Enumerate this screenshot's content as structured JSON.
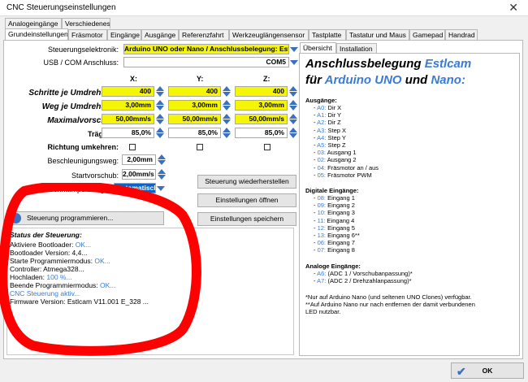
{
  "window": {
    "title": "CNC Steuerungseinstellungen",
    "close": "✕"
  },
  "tabs_row1": [
    "Analogeingänge",
    "Verschiedenes"
  ],
  "tabs_row2": [
    "Grundeinstellungen",
    "Fräsmotor",
    "Eingänge",
    "Ausgänge",
    "Referenzfahrt",
    "Werkzeuglängensensor",
    "Tastplatte",
    "Tastatur und Maus",
    "Gamepad",
    "Handrad"
  ],
  "form": {
    "steuerungselektronik_label": "Steuerungselektronik:",
    "steuerungselektronik_value": "Arduino UNO oder Nano / Anschlussbelegung: Estlcam",
    "usb_label": "USB / COM Anschluss:",
    "usb_value": "COM5",
    "axis_headers": [
      "X:",
      "Y:",
      "Z:"
    ],
    "rows": [
      {
        "label": "Schritte je Umdrehung:",
        "values": [
          "400",
          "400",
          "400"
        ]
      },
      {
        "label": "Weg je Umdrehung:",
        "values": [
          "3,00mm",
          "3,00mm",
          "3,00mm"
        ]
      },
      {
        "label": "Maximalvorschub:",
        "values": [
          "50,00mm/s",
          "50,00mm/s",
          "50,00mm/s"
        ]
      },
      {
        "label": "Trägheit:",
        "values": [
          "85,0%",
          "85,0%",
          "85,0%"
        ]
      }
    ],
    "richtung_label": "Richtung umkehren:",
    "beschleunigung_label": "Beschleunigungsweg:",
    "beschleunigung_value": "2,00mm",
    "startvorschub_label": "Startvorschub:",
    "startvorschub_value": "2,00mm/s",
    "schrittimpuls_label": "Schrittimpulslänge:",
    "schrittimpuls_value": "Automatisch"
  },
  "buttons": {
    "restore": "Steuerung wiederherstellen",
    "open": "Einstellungen öffnen",
    "save": "Einstellungen speichern",
    "program": "Steuerung programmieren...",
    "ok": "OK"
  },
  "status": {
    "title": "Status der Steuerung:",
    "lines": [
      {
        "text": "Aktiviere Bootloader: ",
        "tail": "OK..."
      },
      {
        "text": "Bootloader Version: 4,4...",
        "tail": ""
      },
      {
        "text": "Starte Programmiermodus: ",
        "tail": "OK..."
      },
      {
        "text": "Controller: Atmega328...",
        "tail": ""
      },
      {
        "text": "Hochladen: ",
        "tail": "100 %..."
      },
      {
        "text": "Beende Programmiermodus: ",
        "tail": "OK..."
      },
      {
        "text": "",
        "tail": "CNC Steuerung aktiv..."
      },
      {
        "text": "Firmware Version: Estlcam V11.001 E_328 ...",
        "tail": ""
      }
    ]
  },
  "right_tabs": [
    "Übersicht",
    "Installation"
  ],
  "overview": {
    "heading1a": "Anschlussbelegung ",
    "heading1b": "Estlcam",
    "heading2a": "für ",
    "heading2b": "Arduino UNO",
    "heading2c": " und ",
    "heading2d": "Nano:",
    "outputs_title": "Ausgänge:",
    "outputs": [
      [
        "A0",
        "Dir X"
      ],
      [
        "A1",
        "Dir Y"
      ],
      [
        "A2",
        "Dir Z"
      ],
      [
        "A3",
        "Step X"
      ],
      [
        "A4",
        "Step Y"
      ],
      [
        "A5",
        "Step Z"
      ],
      [
        "03",
        "Ausgang 1"
      ],
      [
        "02",
        "Ausgang 2"
      ],
      [
        "04",
        "Fräsmotor an / aus"
      ],
      [
        "05",
        "Fräsmotor PWM"
      ]
    ],
    "inputs_title": "Digitale Eingänge:",
    "inputs": [
      [
        "08",
        "Eingang 1"
      ],
      [
        "09",
        "Eingang 2"
      ],
      [
        "10",
        "Eingang 3"
      ],
      [
        "11",
        "Eingang 4"
      ],
      [
        "12",
        "Eingang 5"
      ],
      [
        "13",
        "Eingang 6**"
      ],
      [
        "06",
        "Eingang 7"
      ],
      [
        "07",
        "Eingang 8"
      ]
    ],
    "analog_title": "Analoge Eingänge:",
    "analog": [
      [
        "A6",
        "(ADC 1 / Vorschubanpassung)*"
      ],
      [
        "A7",
        "(ADC 2 / Drehzahlanpassung)*"
      ]
    ],
    "note1": "*Nur auf Arduino Nano (und seltenen UNO Clones) verfügbar.",
    "note2": "**Auf Arduino Nano nur nach entfernen der damit verbundenen",
    "note3": "LED nutzbar."
  },
  "colors": {
    "highlight": "#f5f507",
    "accent": "#3b6fc0",
    "link": "#3a7bd5",
    "annotation": "#ff0000"
  }
}
